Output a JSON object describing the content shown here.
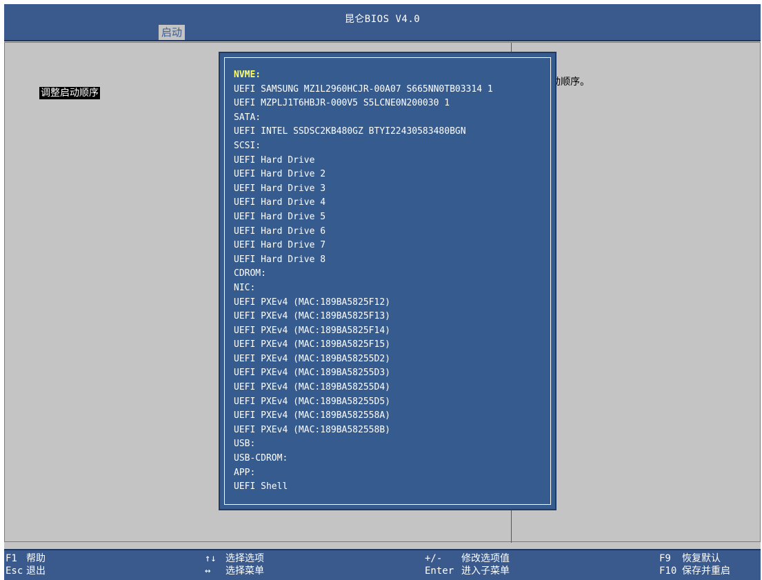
{
  "header": {
    "title": "昆仑BIOS V4.0",
    "active_tab": "启动"
  },
  "left_panel": {
    "items": [
      "调整启动顺序"
    ]
  },
  "help_panel": {
    "text": "动顺序。"
  },
  "boot_order": {
    "items": [
      "NVME:",
      "UEFI SAMSUNG MZ1L2960HCJR-00A07 S665NN0TB03314 1",
      "UEFI MZPLJ1T6HBJR-000V5 S5LCNE0N200030 1",
      "SATA:",
      "UEFI INTEL SSDSC2KB480GZ BTYI22430583480BGN",
      "SCSI:",
      "UEFI Hard Drive",
      "UEFI Hard Drive 2",
      "UEFI Hard Drive 3",
      "UEFI Hard Drive 4",
      "UEFI Hard Drive 5",
      "UEFI Hard Drive 6",
      "UEFI Hard Drive 7",
      "UEFI Hard Drive 8",
      "CDROM:",
      "NIC:",
      "UEFI PXEv4 (MAC:189BA5825F12)",
      "UEFI PXEv4 (MAC:189BA5825F13)",
      "UEFI PXEv4 (MAC:189BA5825F14)",
      "UEFI PXEv4 (MAC:189BA5825F15)",
      "UEFI PXEv4 (MAC:189BA58255D2)",
      "UEFI PXEv4 (MAC:189BA58255D3)",
      "UEFI PXEv4 (MAC:189BA58255D4)",
      "UEFI PXEv4 (MAC:189BA58255D5)",
      "UEFI PXEv4 (MAC:189BA582558A)",
      "UEFI PXEv4 (MAC:189BA582558B)",
      "USB:",
      "USB-CDROM:",
      "APP:",
      "UEFI Shell"
    ]
  },
  "footer": {
    "f1_key": "F1",
    "f1_label": "帮助",
    "esc_key": "Esc",
    "esc_label": "退出",
    "updown_key": "↑↓",
    "updown_label": "选择选项",
    "leftright_key": "↔",
    "leftright_label": "选择菜单",
    "plusminus_key": "+/-",
    "plusminus_label": "修改选项值",
    "enter_key": "Enter",
    "enter_label": "进入子菜单",
    "f9_key": "F9",
    "f9_label": "恢复默认",
    "f10_key": "F10",
    "f10_label": "保存并重启"
  },
  "colors": {
    "bios_blue": "#3a5a8e",
    "panel_gray": "#c4c4c4",
    "popup_blue": "#365b8f",
    "selected_text": "#ffff66"
  }
}
